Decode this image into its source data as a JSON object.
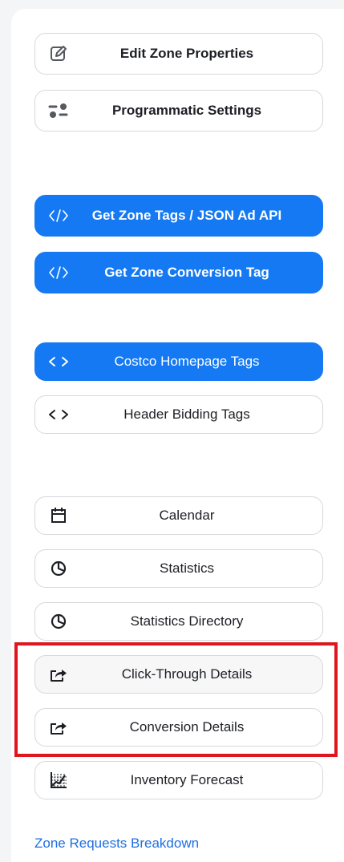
{
  "buttons": {
    "edit_zone_properties": "Edit Zone Properties",
    "programmatic_settings": "Programmatic Settings",
    "get_zone_tags": "Get Zone Tags / JSON Ad API",
    "get_zone_conversion_tag": "Get Zone Conversion Tag",
    "costco_homepage_tags": "Costco Homepage Tags",
    "header_bidding_tags": "Header Bidding Tags",
    "calendar": "Calendar",
    "statistics": "Statistics",
    "statistics_directory": "Statistics Directory",
    "click_through_details": "Click-Through Details",
    "conversion_details": "Conversion Details",
    "inventory_forecast": "Inventory Forecast"
  },
  "links": {
    "zone_requests_breakdown": "Zone Requests Breakdown"
  },
  "icons": {
    "edit": "edit-icon",
    "programmatic": "toggle-settings-icon",
    "code": "code-icon",
    "angle_brackets": "angle-brackets-icon",
    "calendar": "calendar-icon",
    "pie_chart": "pie-chart-icon",
    "share": "share-arrow-icon",
    "forecast": "forecast-chart-icon"
  },
  "colors": {
    "primary": "#1479f2",
    "highlight": "#e0161e",
    "link": "#1f6fe0"
  }
}
